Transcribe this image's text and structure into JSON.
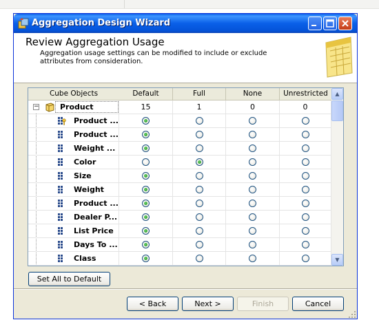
{
  "window": {
    "title": "Aggregation Design Wizard"
  },
  "header": {
    "title": "Review Aggregation Usage",
    "description": "Aggregation usage settings can be modified to include or exclude attributes from consideration."
  },
  "grid": {
    "columns": [
      "Cube Objects",
      "Default",
      "Full",
      "None",
      "Unrestricted"
    ],
    "dimension": {
      "name": "Product",
      "counts": [
        "15",
        "1",
        "0",
        "0"
      ]
    },
    "attributes": [
      {
        "name": "Product ...",
        "icon": "key-attribute-icon",
        "selected": "Default"
      },
      {
        "name": "Product ...",
        "icon": "attribute-icon",
        "selected": "Default"
      },
      {
        "name": "Weight ...",
        "icon": "attribute-icon",
        "selected": "Default"
      },
      {
        "name": "Color",
        "icon": "attribute-icon",
        "selected": "Full"
      },
      {
        "name": "Size",
        "icon": "attribute-icon",
        "selected": "Default"
      },
      {
        "name": "Weight",
        "icon": "attribute-icon",
        "selected": "Default"
      },
      {
        "name": "Product ...",
        "icon": "attribute-icon",
        "selected": "Default"
      },
      {
        "name": "Dealer P...",
        "icon": "attribute-icon",
        "selected": "Default"
      },
      {
        "name": "List Price",
        "icon": "attribute-icon",
        "selected": "Default"
      },
      {
        "name": "Days To ...",
        "icon": "attribute-icon",
        "selected": "Default"
      },
      {
        "name": "Class",
        "icon": "attribute-icon",
        "selected": "Default"
      }
    ]
  },
  "buttons": {
    "set_all_default": "Set All to Default",
    "back": "< Back",
    "next": "Next >",
    "finish": "Finish",
    "cancel": "Cancel"
  },
  "colors": {
    "titlebar": "#0a5ee8",
    "selected_radio": "#1a8a1a",
    "window_bg": "#ece9d8"
  }
}
